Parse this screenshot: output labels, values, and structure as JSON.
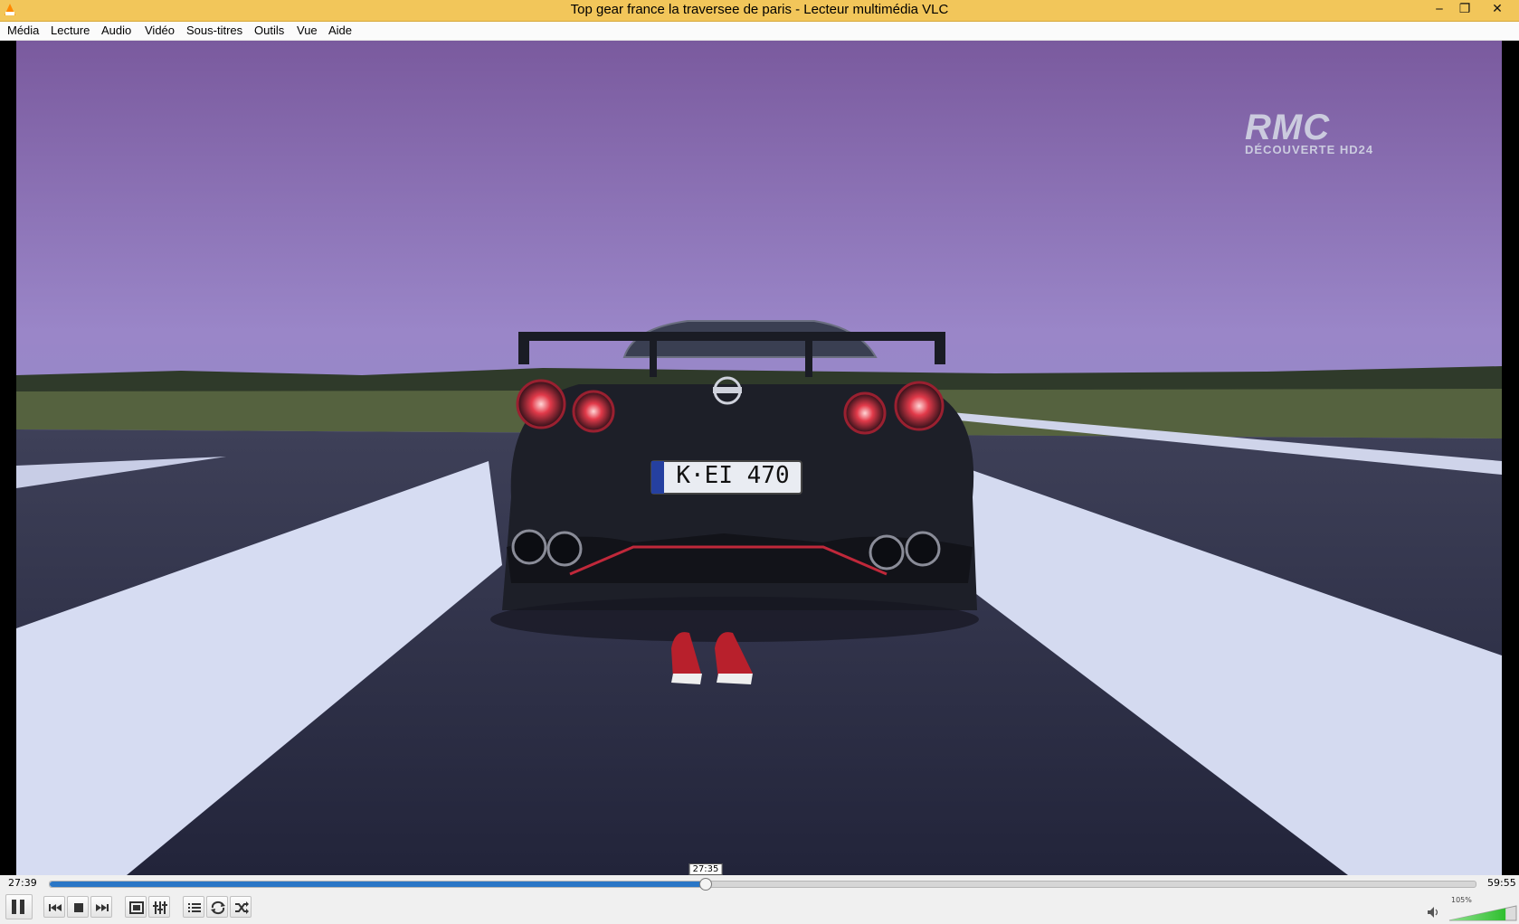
{
  "window": {
    "title": "Top gear france la traversee de paris - Lecteur multimédia VLC",
    "minimize_glyph": "‒",
    "maximize_glyph": "❐",
    "close_glyph": "✕"
  },
  "menu": {
    "items": [
      "Média",
      "Lecture",
      "Audio",
      "Vidéo",
      "Sous-titres",
      "Outils",
      "Vue",
      "Aide"
    ]
  },
  "video": {
    "watermark_main": "RMC",
    "watermark_sub": "DÉCOUVERTE HD24",
    "plate": "K·EI 470"
  },
  "seek": {
    "elapsed": "27:39",
    "total": "59:55",
    "hover_time": "27:35",
    "progress_fraction": 0.46
  },
  "controls": {
    "icons": [
      "pause-icon",
      "previous-icon",
      "stop-icon",
      "next-icon",
      "fullscreen-icon",
      "extended-settings-icon",
      "playlist-icon",
      "loop-icon",
      "shuffle-icon"
    ]
  },
  "volume": {
    "percent_label": "105%",
    "level_fraction": 1.05
  },
  "colors": {
    "titlebar": "#f2c65a",
    "progress": "#2a76c6",
    "volume": "#2fbf2f"
  }
}
